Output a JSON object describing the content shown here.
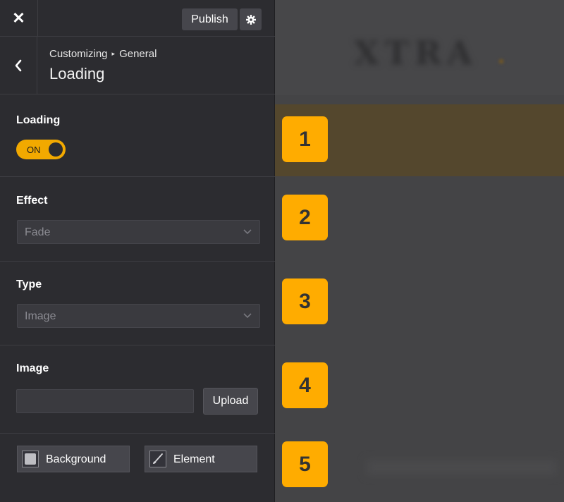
{
  "header": {
    "close_label": "✕",
    "publish_label": "Publish"
  },
  "subheader": {
    "breadcrumb_root": "Customizing",
    "breadcrumb_separator": "▸",
    "breadcrumb_section": "General",
    "title": "Loading"
  },
  "loading": {
    "label": "Loading",
    "toggle_text": "ON"
  },
  "effect": {
    "label": "Effect",
    "value": "Fade"
  },
  "type": {
    "label": "Type",
    "value": "Image"
  },
  "image": {
    "label": "Image",
    "value": "",
    "upload_label": "Upload"
  },
  "tabs": {
    "background_label": "Background",
    "element_label": "Element"
  },
  "badges": [
    "1",
    "2",
    "3",
    "4",
    "5"
  ],
  "preview": {
    "logo_text": "XTRA"
  },
  "colors": {
    "accent": "#f2a900",
    "badge": "#ffac00",
    "panel_bg": "#2c2c30",
    "preview_bg": "#444446"
  }
}
